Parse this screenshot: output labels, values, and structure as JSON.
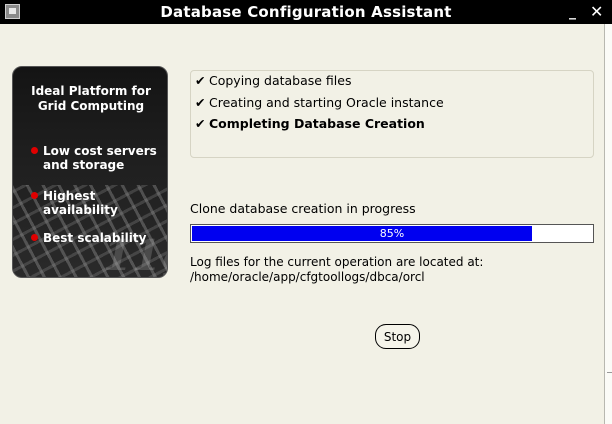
{
  "window": {
    "title": "Database Configuration Assistant",
    "minimize_glyph": "_",
    "close_glyph": "✕"
  },
  "sidebar": {
    "heading_line1": "Ideal Platform for",
    "heading_line2": "Grid Computing",
    "features": [
      {
        "line1": "Low cost servers",
        "line2": "and storage"
      },
      {
        "line1": "Highest availability",
        "line2": ""
      },
      {
        "line1": "Best scalability",
        "line2": ""
      }
    ],
    "watermark": "11g",
    "bullet_color": "#e00000"
  },
  "steps": [
    {
      "check": "✔",
      "label": "Copying database files",
      "status": "done"
    },
    {
      "check": "✔",
      "label": "Creating and starting Oracle instance",
      "status": "done"
    },
    {
      "check": "✔",
      "label": "Completing Database Creation",
      "status": "current"
    }
  ],
  "progress": {
    "message": "Clone database creation in progress",
    "percent": 85,
    "label": "85%",
    "bar_color": "#0000f0"
  },
  "log": {
    "line1": "Log files for the current operation are located at:",
    "path": "/home/oracle/app/cfgtoollogs/dbca/orcl"
  },
  "buttons": {
    "stop": "Stop"
  }
}
